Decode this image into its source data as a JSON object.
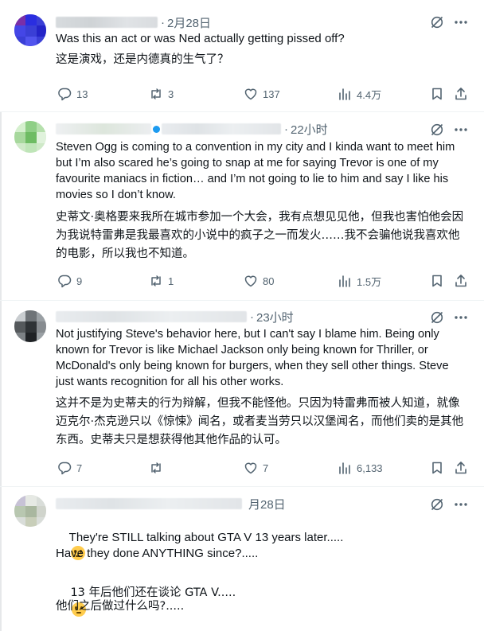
{
  "posts": [
    {
      "time": "2月28日",
      "text_en": "Was this an act or was Ned actually getting pissed off?",
      "text_zh": "这是演戏，还是内德真的生气了？",
      "replies": "13",
      "reposts": "3",
      "likes": "137",
      "views": "4.4万"
    },
    {
      "time": "22小时",
      "text_en": "Steven Ogg is coming to a convention in my city and I kinda want to meet him but I’m also scared he’s going to snap at me for saying Trevor is one of my favourite maniacs in fiction… and I’m not going to lie to him and say I like his movies so I don’t know.",
      "text_zh": "史蒂文·奥格要来我所在城市参加一个大会，我有点想见见他，但我也害怕他会因为我说特雷弗是我最喜欢的小说中的疯子之一而发火……我不会骗他说我喜欢他的电影，所以我也不知道。",
      "replies": "9",
      "reposts": "1",
      "likes": "80",
      "views": "1.5万"
    },
    {
      "time": "23小时",
      "text_en": "Not justifying Steve's behavior here, but I can't say I blame him. Being only known for Trevor is like Michael Jackson only being known for Thriller, or McDonald's only being known for burgers, when they sell other things. Steve just wants recognition for all his other works.",
      "text_zh": "这并不是为史蒂夫的行为辩解，但我不能怪他。只因为特雷弗而被人知道，就像迈克尔·杰克逊只以《惊悚》闻名，或者麦当劳只以汉堡闻名，而他们卖的是其他东西。史蒂夫只是想获得他其他作品的认可。",
      "replies": "7",
      "reposts": "",
      "likes": "7",
      "views": "6,133"
    },
    {
      "time": "月28日",
      "text_en_1": "They're STILL talking about GTA V 13 years later.....",
      "text_en_2": "Have they done ANYTHING since?.....",
      "text_zh_1": "13 年后他们还在谈论 GTA V.....",
      "text_zh_2": "他们之后做过什么吗?....."
    }
  ],
  "icons": {
    "grok": "grok-icon",
    "more": "more-icon",
    "reply": "reply-icon",
    "repost": "repost-icon",
    "like": "like-icon",
    "views": "views-icon",
    "bookmark": "bookmark-icon",
    "share": "share-icon",
    "emoji": "face-with-rolling-eyes"
  },
  "colors": {
    "text": "#0f1419",
    "muted": "#536471",
    "border": "#eff3f4",
    "verified": "#1d9bf0"
  }
}
